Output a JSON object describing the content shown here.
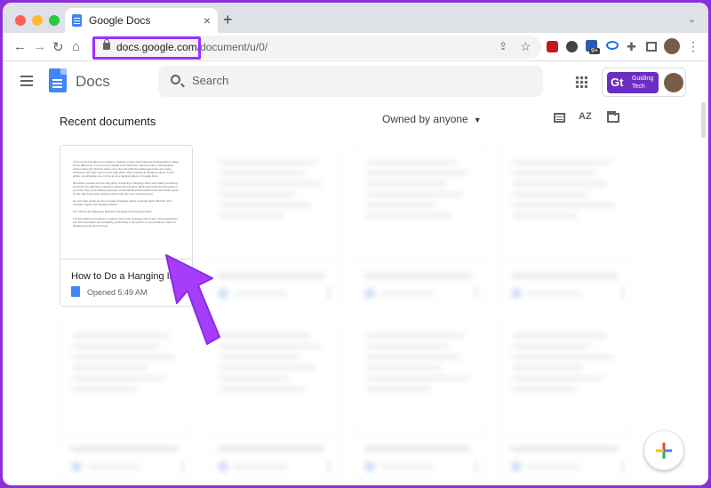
{
  "browser": {
    "tab": {
      "title": "Google Docs",
      "close": "×"
    },
    "new_tab": "+",
    "tab_dropdown": "⌄",
    "nav": {
      "back": "←",
      "forward": "→",
      "reload": "↻",
      "home": "⌂"
    },
    "omnibox": {
      "domain": "docs.google.com",
      "path": "/document/u/0/"
    },
    "toolbar_icons": {
      "share": "⇪",
      "bookmark": "☆",
      "puzzle": "✚",
      "menu": "⋮"
    },
    "extension_badge": "9+"
  },
  "docs": {
    "app_name": "Docs",
    "search": {
      "placeholder": "Search"
    },
    "account": {
      "logo_mark": "Gt",
      "logo_line1": "Guiding",
      "logo_line2": "Tech"
    },
    "section_title": "Recent documents",
    "owner_filter": "Owned by anyone",
    "owner_caret": "▼",
    "sort_label": "AZ",
    "documents": [
      {
        "name": "How to Do a Hanging Indent",
        "meta": "Opened 5:49 AM"
      }
    ],
    "thumbnail_text": [
      "In the world of academic formatting, creating a clean and professional bibliography makes all the difference. If you've ever needed to format those reference lists or bibliography entries where the first line sticks out to the left while the subsequent lines are neatly indented to the right, you're in the right place. We're looking at hanging indents. In this article, we will guide you on how to do a hanging indent on Google Docs.",
      "But before we dive into the nitty-gritty of applying a hanging indent, let's clarify something important: the difference between regular and hanging. While both influence the layout of your text, they serve distinct purposes. Understanding these differences will ensure you're on the right track when deciding which style fits your document best.",
      "So, let's take a look at how to create a hanging indent in Google Docs. But first, let's consider regular and hanging indents.",
      "101. What's the Difference Between a Regular and Hanging Indent",
      "The key difference between a regular indent and a hanging indent lies in their application and how they affect text formatting, particularly in documents or presentations. Here's a detailed look at each of these."
    ]
  }
}
